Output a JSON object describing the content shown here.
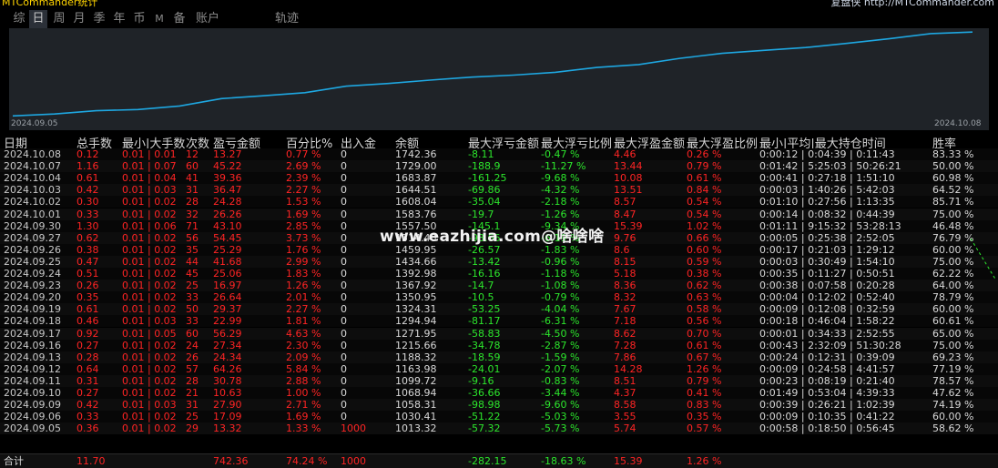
{
  "window": {
    "title": "MTCommander统计",
    "right_text": "复盘侠 http://MTCommander.com"
  },
  "tabs": [
    {
      "label": "综",
      "active": false
    },
    {
      "label": "日",
      "active": true
    },
    {
      "label": "周",
      "active": false
    },
    {
      "label": "月",
      "active": false
    },
    {
      "label": "季",
      "active": false
    },
    {
      "label": "年",
      "active": false
    },
    {
      "label": "币",
      "active": false
    },
    {
      "label": "M",
      "active": false
    },
    {
      "label": "备",
      "active": false
    },
    {
      "label": "账户",
      "active": false
    },
    {
      "label": "轨迹",
      "active": false
    }
  ],
  "chart_data": {
    "type": "line",
    "x_start_label": "2024.09.05",
    "x_end_label": "2024.10.08",
    "x": [
      "2024.09.05",
      "2024.09.06",
      "2024.09.09",
      "2024.09.10",
      "2024.09.11",
      "2024.09.12",
      "2024.09.13",
      "2024.09.16",
      "2024.09.17",
      "2024.09.18",
      "2024.09.19",
      "2024.09.20",
      "2024.09.23",
      "2024.09.24",
      "2024.09.25",
      "2024.09.26",
      "2024.09.27",
      "2024.09.30",
      "2024.10.01",
      "2024.10.02",
      "2024.10.03",
      "2024.10.04",
      "2024.10.07",
      "2024.10.08"
    ],
    "series": [
      {
        "values": [
          1013.32,
          1030.41,
          1058.31,
          1068.94,
          1099.72,
          1163.98,
          1188.32,
          1215.66,
          1271.95,
          1294.94,
          1324.31,
          1350.95,
          1367.92,
          1392.98,
          1434.66,
          1459.95,
          1514.4,
          1557.5,
          1583.76,
          1608.04,
          1644.51,
          1683.87,
          1729.0,
          1742.36
        ]
      }
    ],
    "color": "#1ea7e1",
    "ylim": [
      1000,
      1760
    ],
    "grid": false
  },
  "table": {
    "headers": [
      "日期",
      "总手数",
      "最小|大手数",
      "次数",
      "盈亏金额",
      "百分比%",
      "出入金",
      "余额",
      "最大浮亏金额",
      "最大浮亏比例",
      "最大浮盈金额",
      "最大浮盈比例",
      "最小|平均|最大持仓时间",
      "胜率"
    ],
    "rows": [
      [
        "2024.10.08",
        "0.12",
        "0.01 | 0.01",
        "12",
        "13.27",
        "0.77 %",
        "0",
        "1742.36",
        "-8.11",
        "-0.47 %",
        "4.46",
        "0.26 %",
        "0:00:12 | 0:04:39 | 0:11:43",
        "83.33 %"
      ],
      [
        "2024.10.07",
        "1.16",
        "0.01 | 0.07",
        "60",
        "45.22",
        "2.69 %",
        "0",
        "1729.00",
        "-188.9",
        "-11.27 %",
        "13.44",
        "0.79 %",
        "0:01:42 | 5:25:03 | 50:26:21",
        "50.00 %"
      ],
      [
        "2024.10.04",
        "0.61",
        "0.01 | 0.04",
        "41",
        "39.36",
        "2.39 %",
        "0",
        "1683.87",
        "-161.25",
        "-9.68 %",
        "10.08",
        "0.61 %",
        "0:00:41 | 0:27:18 | 1:51:10",
        "60.98 %"
      ],
      [
        "2024.10.03",
        "0.42",
        "0.01 | 0.03",
        "31",
        "36.47",
        "2.27 %",
        "0",
        "1644.51",
        "-69.86",
        "-4.32 %",
        "13.51",
        "0.84 %",
        "0:00:03 | 1:40:26 | 5:42:03",
        "64.52 %"
      ],
      [
        "2024.10.02",
        "0.30",
        "0.01 | 0.02",
        "28",
        "24.28",
        "1.53 %",
        "0",
        "1608.04",
        "-35.04",
        "-2.18 %",
        "8.57",
        "0.54 %",
        "0:01:10 | 0:27:56 | 1:13:35",
        "85.71 %"
      ],
      [
        "2024.10.01",
        "0.33",
        "0.01 | 0.02",
        "32",
        "26.26",
        "1.69 %",
        "0",
        "1583.76",
        "-19.7",
        "-1.26 %",
        "8.47",
        "0.54 %",
        "0:00:14 | 0:08:32 | 0:44:39",
        "75.00 %"
      ],
      [
        "2024.09.30",
        "1.30",
        "0.01 | 0.06",
        "71",
        "43.10",
        "2.85 %",
        "0",
        "1557.50",
        "-145.1",
        "-9.34 %",
        "15.39",
        "1.02 %",
        "0:01:11 | 9:15:32 | 53:28:13",
        "46.48 %"
      ],
      [
        "2024.09.27",
        "0.62",
        "0.01 | 0.02",
        "56",
        "54.45",
        "3.73 %",
        "0",
        "1514.40",
        "-93.66",
        "-6.19 %",
        "9.76",
        "0.66 %",
        "0:00:05 | 0:25:38 | 2:52:05",
        "76.79 %"
      ],
      [
        "2024.09.26",
        "0.38",
        "0.01 | 0.02",
        "35",
        "25.29",
        "1.76 %",
        "0",
        "1459.95",
        "-26.57",
        "-1.83 %",
        "8.6",
        "0.60 %",
        "0:00:17 | 0:21:03 | 1:29:12",
        "60.00 %"
      ],
      [
        "2024.09.25",
        "0.47",
        "0.01 | 0.02",
        "44",
        "41.68",
        "2.99 %",
        "0",
        "1434.66",
        "-13.42",
        "-0.96 %",
        "8.15",
        "0.59 %",
        "0:00:03 | 0:30:49 | 1:54:10",
        "75.00 %"
      ],
      [
        "2024.09.24",
        "0.51",
        "0.01 | 0.02",
        "45",
        "25.06",
        "1.83 %",
        "0",
        "1392.98",
        "-16.16",
        "-1.18 %",
        "5.18",
        "0.38 %",
        "0:00:35 | 0:11:27 | 0:50:51",
        "62.22 %"
      ],
      [
        "2024.09.23",
        "0.26",
        "0.01 | 0.02",
        "25",
        "16.97",
        "1.26 %",
        "0",
        "1367.92",
        "-14.7",
        "-1.08 %",
        "8.36",
        "0.62 %",
        "0:00:38 | 0:07:58 | 0:20:28",
        "64.00 %"
      ],
      [
        "2024.09.20",
        "0.35",
        "0.01 | 0.02",
        "33",
        "26.64",
        "2.01 %",
        "0",
        "1350.95",
        "-10.5",
        "-0.79 %",
        "8.32",
        "0.63 %",
        "0:00:04 | 0:12:02 | 0:52:40",
        "78.79 %"
      ],
      [
        "2024.09.19",
        "0.61",
        "0.01 | 0.02",
        "50",
        "29.37",
        "2.27 %",
        "0",
        "1324.31",
        "-53.25",
        "-4.04 %",
        "7.67",
        "0.58 %",
        "0:00:09 | 0:12:08 | 0:32:59",
        "60.00 %"
      ],
      [
        "2024.09.18",
        "0.46",
        "0.01 | 0.03",
        "33",
        "22.99",
        "1.81 %",
        "0",
        "1294.94",
        "-81.17",
        "-6.31 %",
        "7.18",
        "0.56 %",
        "0:00:18 | 0:46:04 | 1:58:22",
        "60.61 %"
      ],
      [
        "2024.09.17",
        "0.92",
        "0.01 | 0.05",
        "60",
        "56.29",
        "4.63 %",
        "0",
        "1271.95",
        "-58.83",
        "-4.50 %",
        "8.62",
        "0.70 %",
        "0:00:01 | 0:34:33 | 2:52:55",
        "65.00 %"
      ],
      [
        "2024.09.16",
        "0.27",
        "0.01 | 0.02",
        "24",
        "27.34",
        "2.30 %",
        "0",
        "1215.66",
        "-34.78",
        "-2.87 %",
        "7.28",
        "0.61 %",
        "0:00:43 | 2:32:09 | 51:30:28",
        "75.00 %"
      ],
      [
        "2024.09.13",
        "0.28",
        "0.01 | 0.02",
        "26",
        "24.34",
        "2.09 %",
        "0",
        "1188.32",
        "-18.59",
        "-1.59 %",
        "7.86",
        "0.67 %",
        "0:00:24 | 0:12:31 | 0:39:09",
        "69.23 %"
      ],
      [
        "2024.09.12",
        "0.64",
        "0.01 | 0.02",
        "57",
        "64.26",
        "5.84 %",
        "0",
        "1163.98",
        "-24.01",
        "-2.07 %",
        "14.28",
        "1.26 %",
        "0:00:09 | 0:24:58 | 4:41:57",
        "77.19 %"
      ],
      [
        "2024.09.11",
        "0.31",
        "0.01 | 0.02",
        "28",
        "30.78",
        "2.88 %",
        "0",
        "1099.72",
        "-9.16",
        "-0.83 %",
        "8.51",
        "0.79 %",
        "0:00:23 | 0:08:19 | 0:21:40",
        "78.57 %"
      ],
      [
        "2024.09.10",
        "0.27",
        "0.01 | 0.02",
        "21",
        "10.63",
        "1.00 %",
        "0",
        "1068.94",
        "-36.66",
        "-3.44 %",
        "4.37",
        "0.41 %",
        "0:01:49 | 0:53:04 | 4:39:33",
        "47.62 %"
      ],
      [
        "2024.09.09",
        "0.42",
        "0.01 | 0.03",
        "31",
        "27.90",
        "2.71 %",
        "0",
        "1058.31",
        "-98.98",
        "-9.60 %",
        "8.58",
        "0.83 %",
        "0:00:39 | 0:26:21 | 1:02:39",
        "74.19 %"
      ],
      [
        "2024.09.06",
        "0.33",
        "0.01 | 0.02",
        "25",
        "17.09",
        "1.69 %",
        "0",
        "1030.41",
        "-51.22",
        "-5.03 %",
        "3.55",
        "0.35 %",
        "0:00:09 | 0:10:35 | 0:41:22",
        "60.00 %"
      ],
      [
        "2024.09.05",
        "0.36",
        "0.01 | 0.02",
        "29",
        "13.32",
        "1.33 %",
        "1000",
        "1013.32",
        "-57.32",
        "-5.73 %",
        "5.74",
        "0.57 %",
        "0:00:58 | 0:18:50 | 0:56:45",
        "58.62 %"
      ]
    ],
    "totals": [
      "合计",
      "11.70",
      "",
      "",
      "742.36",
      "74.24 %",
      "1000",
      "",
      "-282.15",
      "-18.63 %",
      "15.39",
      "1.26 %",
      "",
      ""
    ]
  },
  "watermark": "www.eazhijia.com@啥啥啥",
  "colors": {
    "positive": "#ff2424",
    "negative": "#2ce62c",
    "line": "#1ea7e1",
    "chart_bg": "#1f2328"
  }
}
